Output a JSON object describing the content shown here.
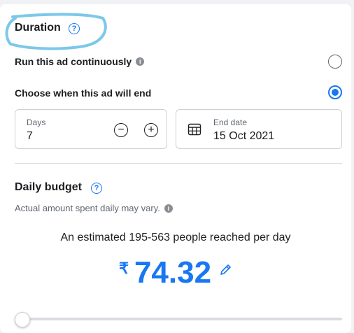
{
  "duration": {
    "title": "Duration",
    "help_glyph": "?",
    "options": [
      {
        "label": "Run this ad continuously",
        "selected": false
      },
      {
        "label": "Choose when this ad will end",
        "selected": true
      }
    ],
    "days": {
      "label": "Days",
      "value": "7",
      "minus": "−",
      "plus": "+"
    },
    "end_date": {
      "label": "End date",
      "value": "15 Oct 2021"
    }
  },
  "budget": {
    "title": "Daily budget",
    "help_glyph": "?",
    "note": "Actual amount spent daily may vary.",
    "estimate": "An estimated 195-563 people reached per day",
    "currency": "₹",
    "amount": "74.32",
    "slider_fraction": 0
  },
  "info_glyph": "i",
  "colors": {
    "accent": "#1877f2",
    "annotation": "#7cc8ea"
  }
}
